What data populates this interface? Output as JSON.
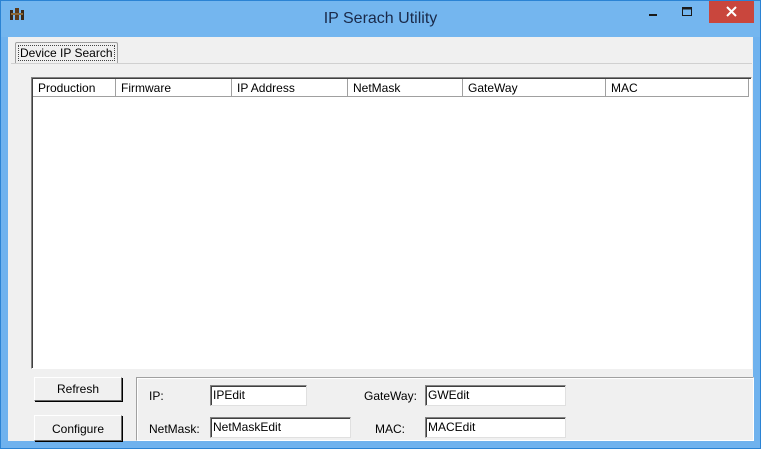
{
  "window": {
    "title": "IP Serach Utility",
    "app_icon": "app-icon",
    "controls": {
      "minimize_icon": "minimize-icon",
      "maximize_icon": "maximize-icon",
      "close_icon": "close-icon"
    }
  },
  "tabs": [
    {
      "label": "Device IP Search",
      "active": true
    }
  ],
  "device_list": {
    "columns": [
      "Production",
      "Firmware",
      "IP Address",
      "NetMask",
      "GateWay",
      "MAC"
    ],
    "rows": []
  },
  "buttons": {
    "refresh": "Refresh",
    "configure": "Configure"
  },
  "form": {
    "ip_label": "IP:",
    "ip_value": "IPEdit",
    "netmask_label": "NetMask:",
    "netmask_value": "NetMaskEdit",
    "gateway_label": "GateWay:",
    "gateway_value": "GWEdit",
    "mac_label": "MAC:",
    "mac_value": "MACEdit"
  },
  "colors": {
    "titlebar": "#74b6ef",
    "close_button": "#c9463d",
    "client_bg": "#f0f0f0"
  }
}
